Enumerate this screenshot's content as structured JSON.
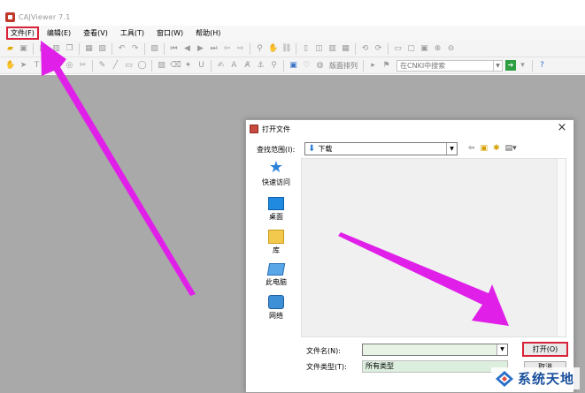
{
  "app": {
    "title": "CAJViewer 7.1"
  },
  "menu": {
    "items": [
      {
        "label": "文件(F)",
        "name": "menu-file"
      },
      {
        "label": "编辑(E)",
        "name": "menu-edit"
      },
      {
        "label": "查看(V)",
        "name": "menu-view"
      },
      {
        "label": "工具(T)",
        "name": "menu-tools"
      },
      {
        "label": "窗口(W)",
        "name": "menu-window"
      },
      {
        "label": "帮助(H)",
        "name": "menu-help"
      }
    ]
  },
  "toolbar": {
    "layout_label": "版面排列",
    "search_placeholder": "在CNKI中搜索"
  },
  "dialog": {
    "title": "打开文件",
    "look_in_label": "查找范围(I):",
    "look_in_value": "下载",
    "places": [
      "快速访问",
      "桌面",
      "库",
      "此电脑",
      "网络"
    ],
    "filename_label": "文件名(N):",
    "filename_value": "",
    "filetype_label": "文件类型(T):",
    "filetype_value": "所有类型",
    "open_label": "打开(O)",
    "cancel_label": "取消"
  },
  "watermark": {
    "text": "系统天地"
  },
  "colors": {
    "highlight": "#d9233a",
    "arrow": "#e020e8",
    "workspace": "#a9a9a9"
  }
}
